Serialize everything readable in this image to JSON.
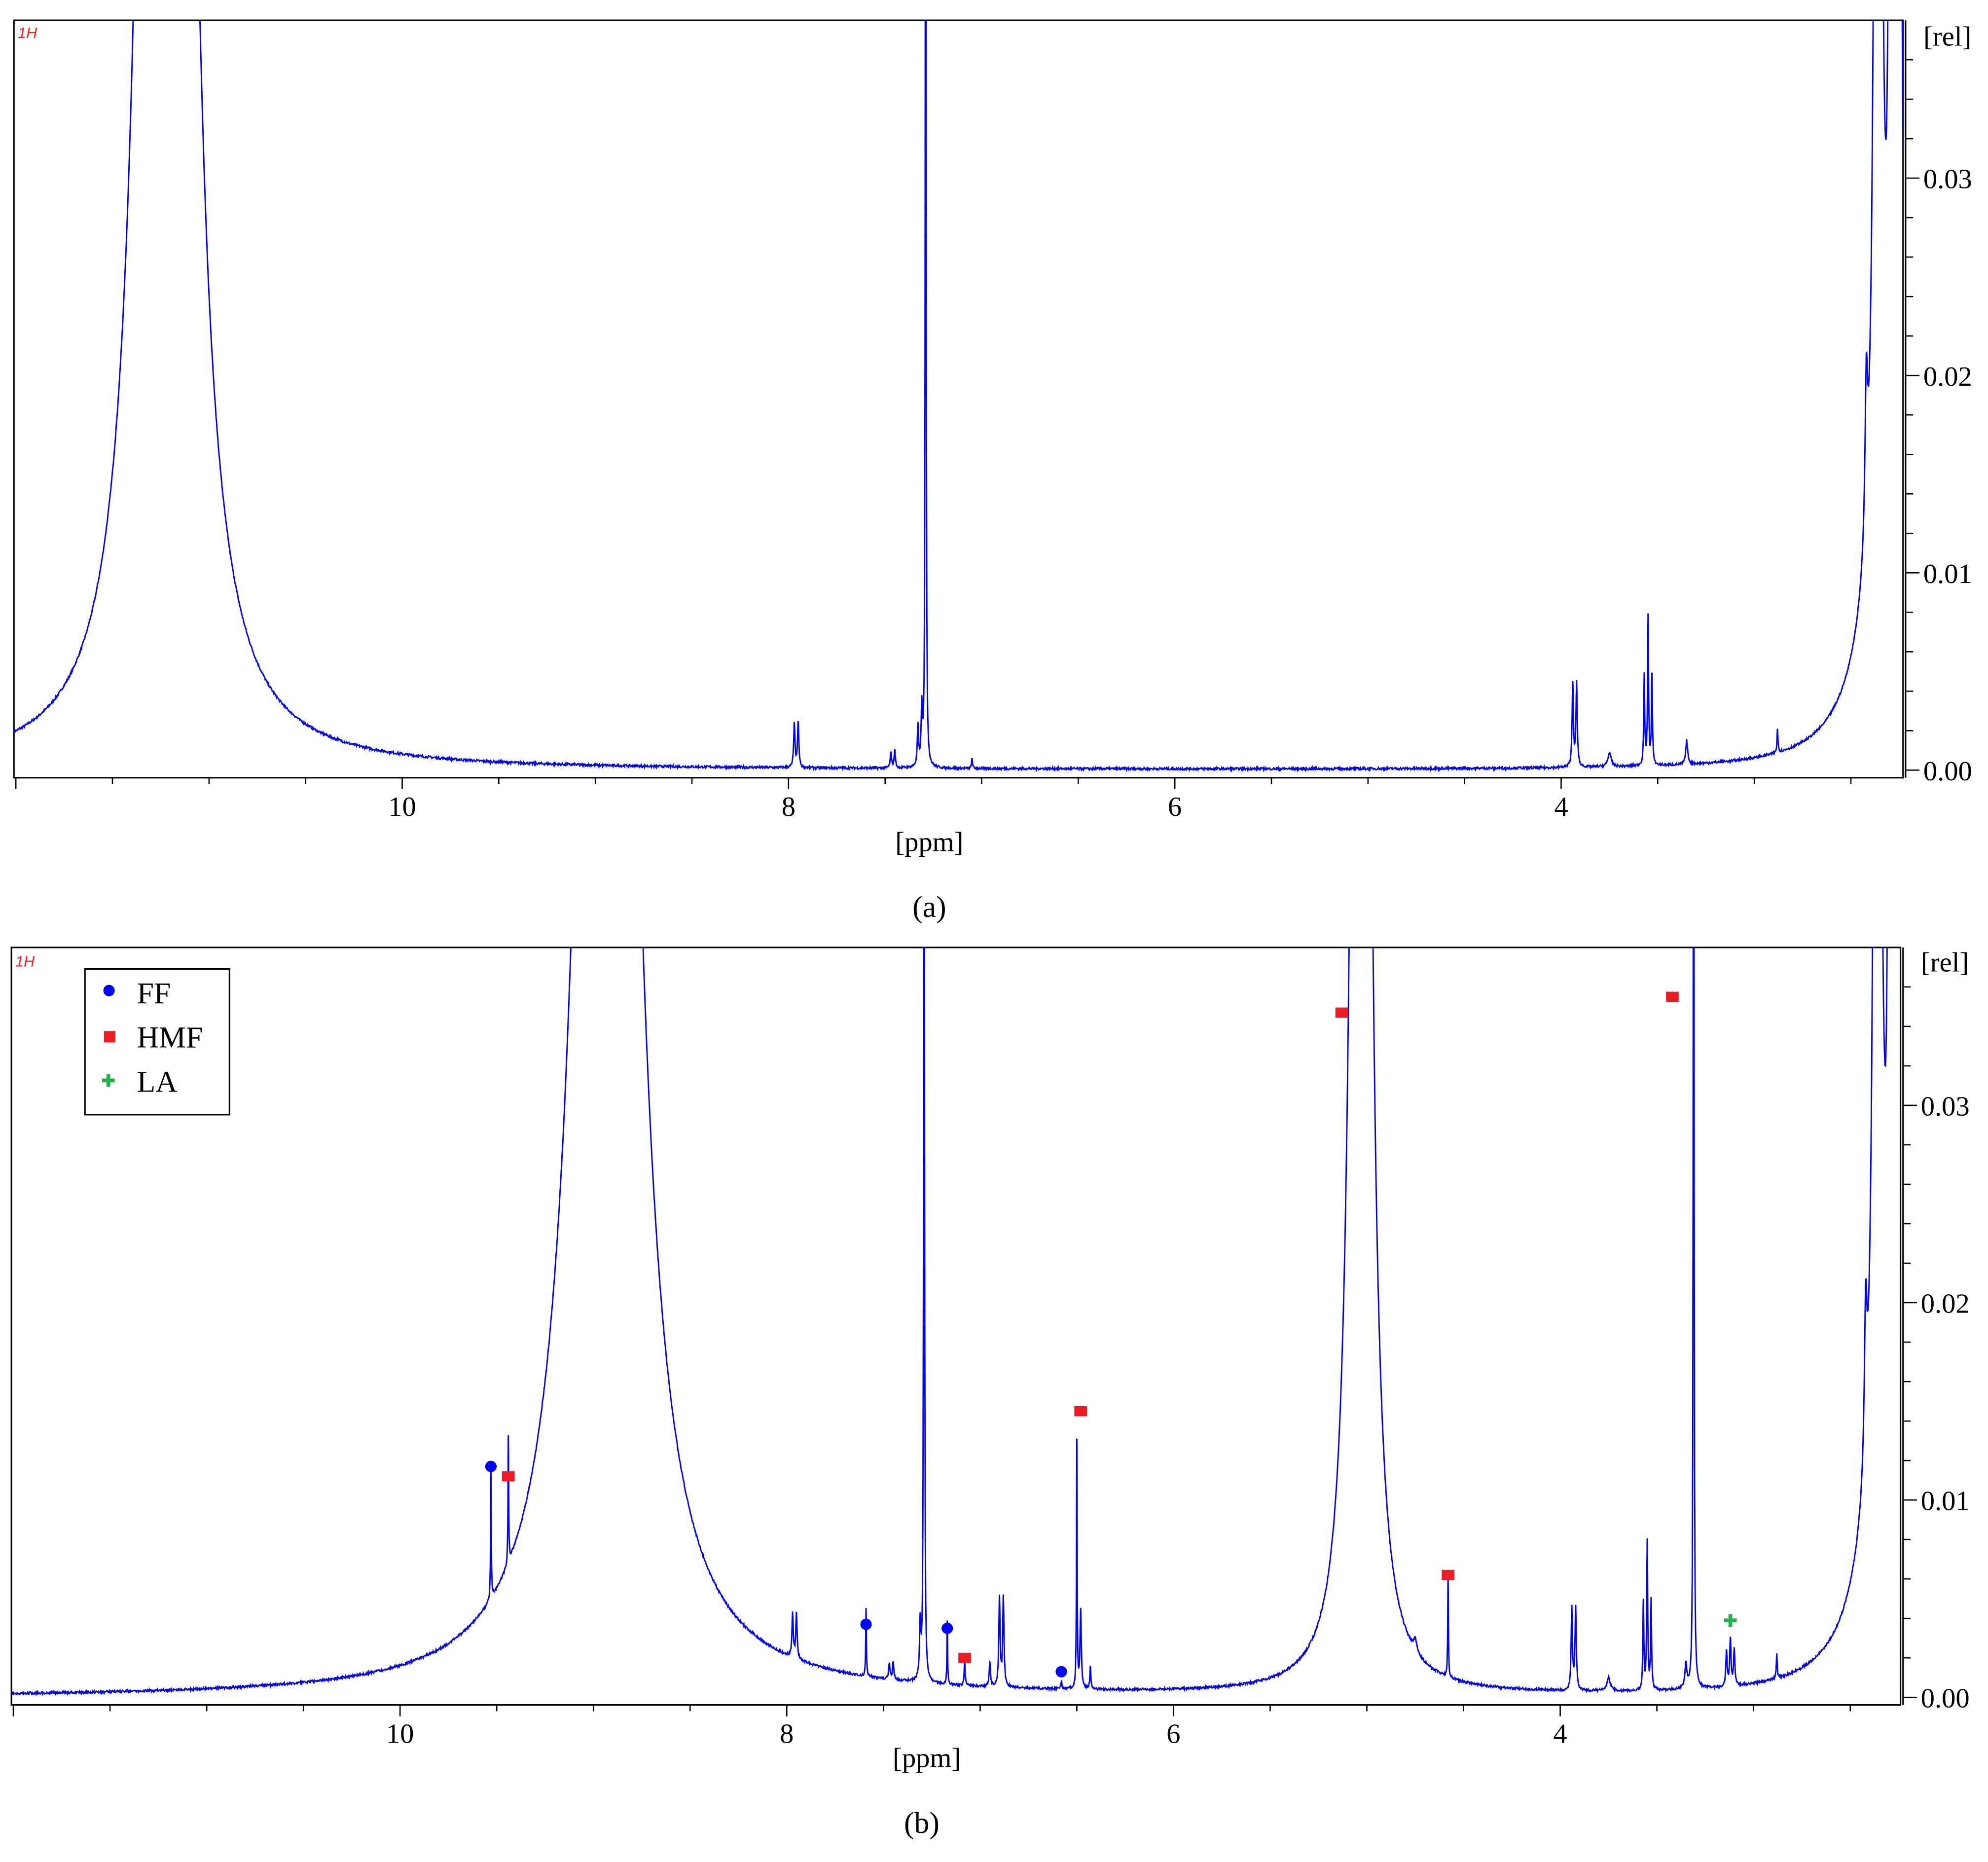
{
  "colors": {
    "spectrum": "#0000ff",
    "FF": "#0000ff",
    "HMF": "#ed1c24",
    "LA": "#22b14c",
    "tag": "#ff2020"
  },
  "chart_data": [
    {
      "type": "line",
      "panel_label": "(a)",
      "nucleus_tag": "1H",
      "xlabel": "[ppm]",
      "ylabel": "[rel]",
      "xlim": [
        12.01,
        2.23
      ],
      "ylim": [
        0.0,
        0.038
      ],
      "x_ticks": [
        "10",
        "8",
        "6",
        "4"
      ],
      "y_ticks": [
        "0.00",
        "0.01",
        "0.02",
        "0.03"
      ],
      "peaks_ppm_height_halfwidth": [
        [
          11.22,
          0.6,
          0.045
        ],
        [
          7.97,
          0.0022,
          0.004
        ],
        [
          7.95,
          0.0023,
          0.004
        ],
        [
          7.47,
          0.0008,
          0.004
        ],
        [
          7.45,
          0.0009,
          0.004
        ],
        [
          7.33,
          0.002,
          0.004
        ],
        [
          7.31,
          0.0028,
          0.004
        ],
        [
          7.29,
          0.08,
          0.002
        ],
        [
          7.05,
          0.0005,
          0.003
        ],
        [
          3.94,
          0.0042,
          0.004
        ],
        [
          3.92,
          0.0042,
          0.004
        ],
        [
          3.75,
          0.0007,
          0.01
        ],
        [
          3.57,
          0.0045,
          0.003
        ],
        [
          3.55,
          0.0075,
          0.003
        ],
        [
          3.53,
          0.0045,
          0.003
        ],
        [
          3.35,
          0.0012,
          0.006
        ],
        [
          2.88,
          0.0012,
          0.003
        ],
        [
          2.42,
          0.0075,
          0.008
        ],
        [
          2.36,
          0.2,
          0.01
        ],
        [
          2.3,
          0.05,
          0.005
        ],
        [
          2.26,
          0.2,
          0.01
        ],
        [
          2.3,
          0.012,
          0.15
        ]
      ],
      "legend": [],
      "markers": []
    },
    {
      "type": "line",
      "panel_label": "(b)",
      "nucleus_tag": "1H",
      "xlabel": "[ppm]",
      "ylabel": "[rel]",
      "xlim": [
        12.01,
        2.24
      ],
      "ylim": [
        0.0,
        0.038
      ],
      "x_ticks": [
        "10",
        "8",
        "6",
        "4"
      ],
      "y_ticks": [
        "0.00",
        "0.01",
        "0.02",
        "0.03"
      ],
      "peaks_ppm_height_halfwidth": [
        [
          8.93,
          0.13,
          0.12
        ],
        [
          9.53,
          0.0065,
          0.002
        ],
        [
          9.44,
          0.0065,
          0.002
        ],
        [
          7.97,
          0.0022,
          0.004
        ],
        [
          7.95,
          0.0023,
          0.004
        ],
        [
          7.59,
          0.0035,
          0.002
        ],
        [
          7.47,
          0.0008,
          0.004
        ],
        [
          7.45,
          0.0009,
          0.004
        ],
        [
          7.31,
          0.0028,
          0.004
        ],
        [
          7.29,
          0.08,
          0.002
        ],
        [
          7.17,
          0.0032,
          0.002
        ],
        [
          7.08,
          0.0012,
          0.003
        ],
        [
          6.9,
          0.0045,
          0.004
        ],
        [
          6.88,
          0.0045,
          0.004
        ],
        [
          6.95,
          0.0012,
          0.004
        ],
        [
          6.58,
          0.0004,
          0.003
        ],
        [
          6.5,
          0.0125,
          0.002
        ],
        [
          6.48,
          0.004,
          0.004
        ],
        [
          6.43,
          0.0012,
          0.003
        ],
        [
          5.03,
          0.2,
          0.03
        ],
        [
          4.75,
          0.0006,
          0.01
        ],
        [
          4.58,
          0.0052,
          0.002
        ],
        [
          3.94,
          0.0042,
          0.004
        ],
        [
          3.92,
          0.0042,
          0.004
        ],
        [
          3.75,
          0.0007,
          0.01
        ],
        [
          3.57,
          0.0045,
          0.003
        ],
        [
          3.55,
          0.0075,
          0.003
        ],
        [
          3.53,
          0.0045,
          0.003
        ],
        [
          3.35,
          0.0012,
          0.006
        ],
        [
          3.31,
          0.08,
          0.002
        ],
        [
          3.14,
          0.0018,
          0.004
        ],
        [
          3.12,
          0.0024,
          0.004
        ],
        [
          3.1,
          0.0018,
          0.004
        ],
        [
          2.88,
          0.0012,
          0.003
        ],
        [
          2.42,
          0.0075,
          0.008
        ],
        [
          2.36,
          0.2,
          0.01
        ],
        [
          2.3,
          0.05,
          0.005
        ],
        [
          2.26,
          0.2,
          0.01
        ],
        [
          2.3,
          0.012,
          0.15
        ]
      ],
      "legend": [
        {
          "label": "FF",
          "shape": "circle"
        },
        {
          "label": "HMF",
          "shape": "square"
        },
        {
          "label": "LA",
          "shape": "cross"
        }
      ],
      "markers": [
        {
          "series": "FF",
          "ppm": 9.53,
          "rel": 0.0117
        },
        {
          "series": "FF",
          "ppm": 7.59,
          "rel": 0.0037
        },
        {
          "series": "FF",
          "ppm": 7.17,
          "rel": 0.0035
        },
        {
          "series": "FF",
          "ppm": 6.58,
          "rel": 0.0013
        },
        {
          "series": "HMF",
          "ppm": 9.44,
          "rel": 0.0112
        },
        {
          "series": "HMF",
          "ppm": 7.08,
          "rel": 0.002
        },
        {
          "series": "HMF",
          "ppm": 6.48,
          "rel": 0.0145
        },
        {
          "series": "HMF",
          "ppm": 5.13,
          "rel": 0.0347
        },
        {
          "series": "HMF",
          "ppm": 4.58,
          "rel": 0.0062
        },
        {
          "series": "HMF",
          "ppm": 3.42,
          "rel": 0.0355
        },
        {
          "series": "LA",
          "ppm": 3.12,
          "rel": 0.0039
        }
      ]
    }
  ]
}
